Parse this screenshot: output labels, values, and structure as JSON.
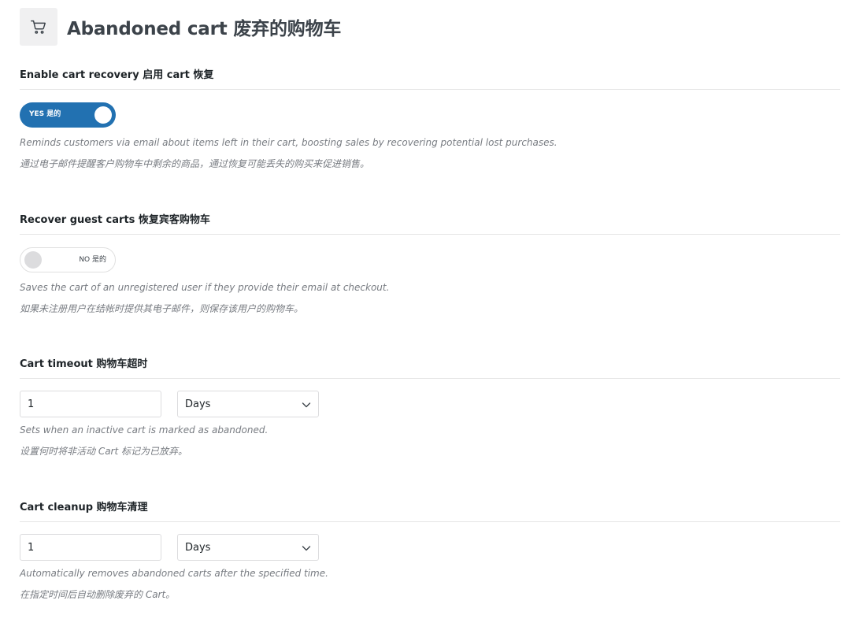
{
  "header": {
    "icon": "cart-icon",
    "title": "Abandoned cart  废弃的购物车"
  },
  "sections": {
    "enable_recovery": {
      "title": "Enable cart recovery  启用 cart 恢复",
      "toggle": {
        "state": "on",
        "label": "YES  是的"
      },
      "desc_en": "Reminds customers via email about items left in their cart, boosting sales by recovering potential lost purchases.",
      "desc_zh": "通过电子邮件提醒客户购物车中剩余的商品，通过恢复可能丢失的购买来促进销售。"
    },
    "guest_carts": {
      "title": "Recover guest carts  恢复宾客购物车",
      "toggle": {
        "state": "off",
        "label": "NO  是的"
      },
      "desc_en": "Saves the cart of an unregistered user if they provide their email at checkout.",
      "desc_zh": "如果未注册用户在结帐时提供其电子邮件，则保存该用户的购物车。"
    },
    "timeout": {
      "title": "Cart timeout  购物车超时",
      "value": "1",
      "unit": "Days",
      "desc_en": "Sets when an inactive cart is marked as abandoned.",
      "desc_zh": "设置何时将非活动 Cart 标记为已放弃。"
    },
    "cleanup": {
      "title": "Cart cleanup  购物车清理",
      "value": "1",
      "unit": "Days",
      "desc_en": "Automatically removes abandoned carts after the specified time.",
      "desc_zh": "在指定时间后自动删除废弃的 Cart。"
    }
  },
  "colors": {
    "toggle_on": "#2271b1",
    "toggle_off_knob": "#dcdcde",
    "description": "#787c82",
    "divider": "#e5e5e5"
  }
}
